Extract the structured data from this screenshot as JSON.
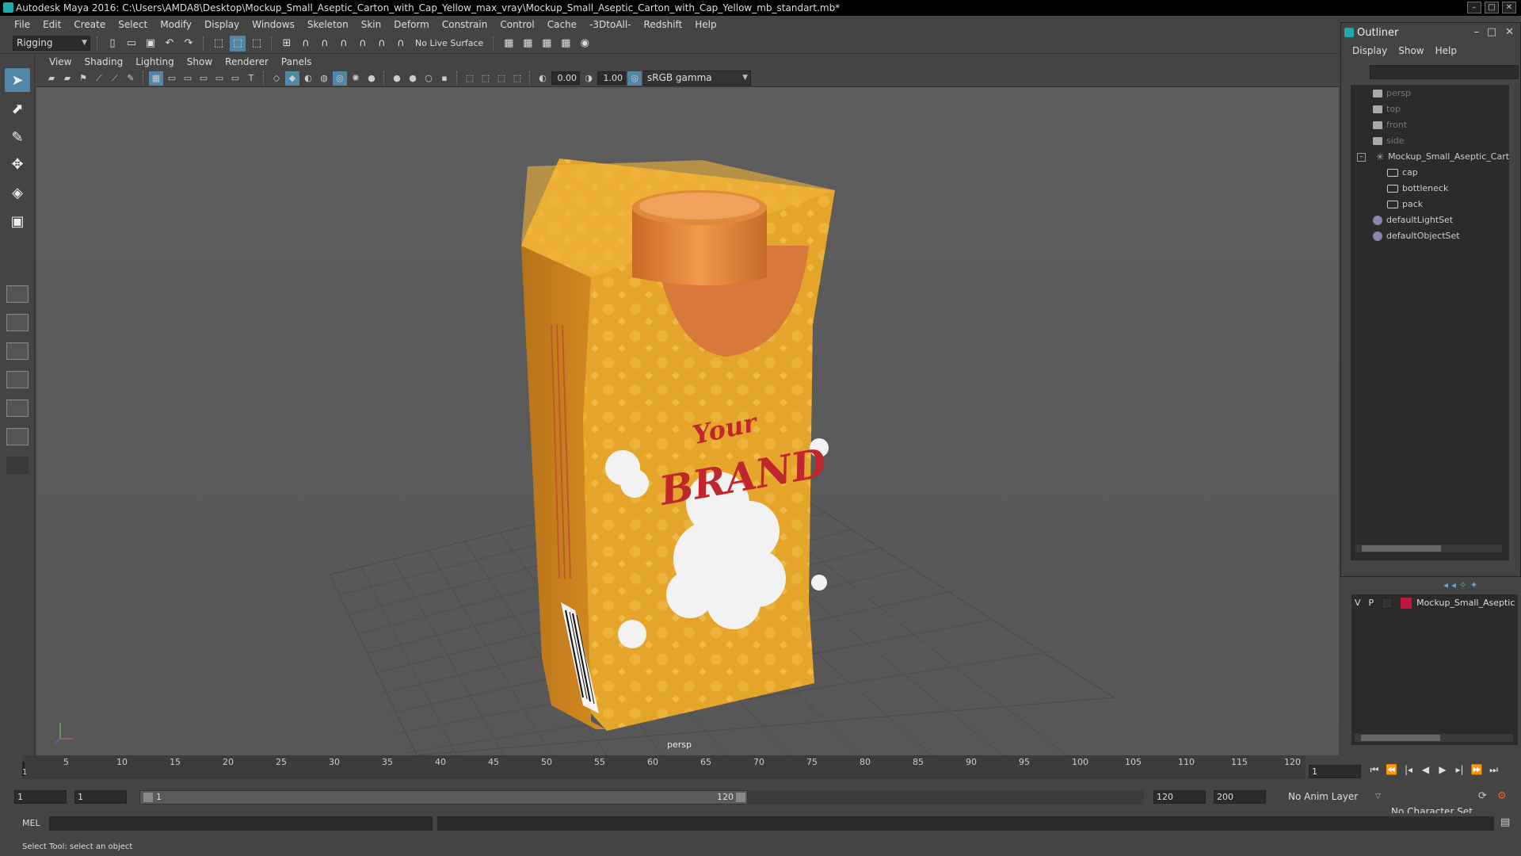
{
  "window": {
    "title": "Autodesk Maya 2016: C:\\Users\\AMDA8\\Desktop\\Mockup_Small_Aseptic_Carton_with_Cap_Yellow_max_vray\\Mockup_Small_Aseptic_Carton_with_Cap_Yellow_mb_standart.mb*"
  },
  "menu": {
    "items": [
      "File",
      "Edit",
      "Create",
      "Select",
      "Modify",
      "Display",
      "Windows",
      "Skeleton",
      "Skin",
      "Deform",
      "Constrain",
      "Control",
      "Cache",
      "-3DtoAll-",
      "Redshift",
      "Help"
    ]
  },
  "statusline": {
    "mode": "Rigging",
    "live_surface": "No Live Surface"
  },
  "viewport": {
    "menu": [
      "View",
      "Shading",
      "Lighting",
      "Show",
      "Renderer",
      "Panels"
    ],
    "exposure": "0.00",
    "gamma": "1.00",
    "color_space": "sRGB gamma",
    "camera_label": "persp",
    "product": {
      "brand_line1": "Your",
      "brand_line2": "BRAND"
    }
  },
  "outliner": {
    "title": "Outliner",
    "menu": [
      "Display",
      "Show",
      "Help"
    ],
    "items": [
      {
        "label": "persp"
      },
      {
        "label": "top"
      },
      {
        "label": "front"
      },
      {
        "label": "side"
      },
      {
        "label": "Mockup_Small_Aseptic_Cart"
      },
      {
        "label": "cap"
      },
      {
        "label": "bottleneck"
      },
      {
        "label": "pack"
      },
      {
        "label": "defaultLightSet"
      },
      {
        "label": "defaultObjectSet"
      }
    ]
  },
  "layers": {
    "row": {
      "v": "V",
      "p": "P",
      "name": "Mockup_Small_Aseptic",
      "color": "#c0163c"
    }
  },
  "timeline": {
    "ticks": [
      "5",
      "10",
      "15",
      "20",
      "25",
      "30",
      "35",
      "40",
      "45",
      "50",
      "55",
      "60",
      "65",
      "70",
      "75",
      "80",
      "85",
      "90",
      "95",
      "100",
      "105",
      "110",
      "115",
      "120"
    ],
    "start_marker": "1",
    "current_frame": "1"
  },
  "range": {
    "start": "1",
    "start2": "1",
    "slider_start": "1",
    "slider_end": "120",
    "end": "120",
    "end2": "200",
    "anim_layer": "No Anim Layer",
    "character_set": "No Character Set"
  },
  "cmdline": {
    "label": "MEL"
  },
  "helpline": {
    "text": "Select Tool: select an object"
  },
  "colors": {
    "carton": "#e5a52b",
    "cap": "#d97a2e",
    "accent": "#5285a6"
  }
}
